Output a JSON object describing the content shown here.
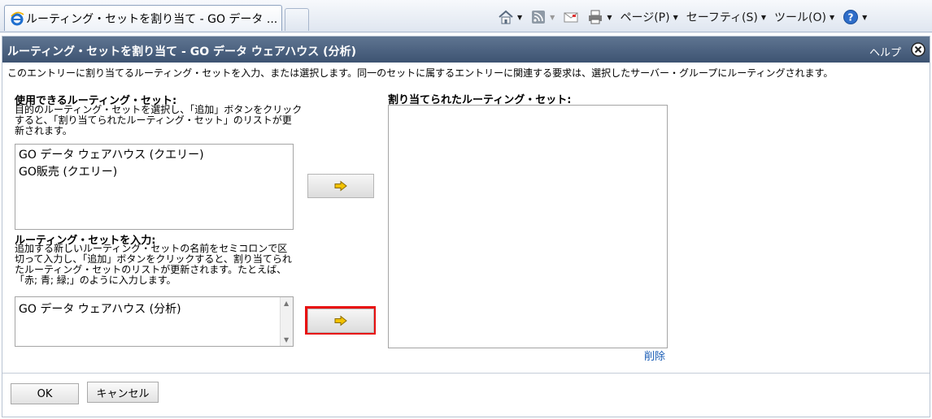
{
  "browser": {
    "tab_title": "ルーティング・セットを割り当て - GO データ ...",
    "toolbar": {
      "page_label": "ページ(P)",
      "safety_label": "セーフティ(S)",
      "tools_label": "ツール(O)"
    },
    "icons": [
      "ie-logo-icon",
      "home-icon",
      "rss-icon",
      "mail-icon",
      "print-icon",
      "help-icon"
    ]
  },
  "dialog": {
    "title": "ルーティング・セットを割り当て - GO データ ウェアハウス (分析)",
    "help_label": "ヘルプ",
    "description": "このエントリーに割り当てるルーティング・セットを入力、または選択します。同一のセットに属するエントリーに関連する要求は、選択したサーバー・グループにルーティングされます。",
    "available": {
      "heading": "使用できるルーティング・セット:",
      "help": [
        "目的のルーティング・セットを選択し、「追加」ボタンをクリック",
        "すると、「割り当てられたルーティング・セット」のリストが更",
        "新されます。"
      ],
      "items": [
        "GO データ ウェアハウス (クエリー)",
        "GO販売 (クエリー)"
      ]
    },
    "entry": {
      "heading": "ルーティング・セットを入力:",
      "help": [
        "追加する新しいルーティング・セットの名前をセミコロンで区",
        "切って入力し、「追加」ボタンをクリックすると、割り当てられ",
        "たルーティング・セットのリストが更新されます。たとえば、",
        "「赤; 青; 緑;」のように入力します。"
      ],
      "value": "GO データ ウェアハウス (分析)"
    },
    "assigned": {
      "heading": "割り当てられたルーティング・セット:",
      "items": [],
      "delete_label": "削除"
    },
    "buttons": {
      "ok_label": "OK",
      "cancel_label": "キャンセル"
    }
  },
  "colors": {
    "header_bg": "#4a6180",
    "highlight": "#e81010",
    "arrow": "#f2c200",
    "link": "#1a5db5"
  }
}
